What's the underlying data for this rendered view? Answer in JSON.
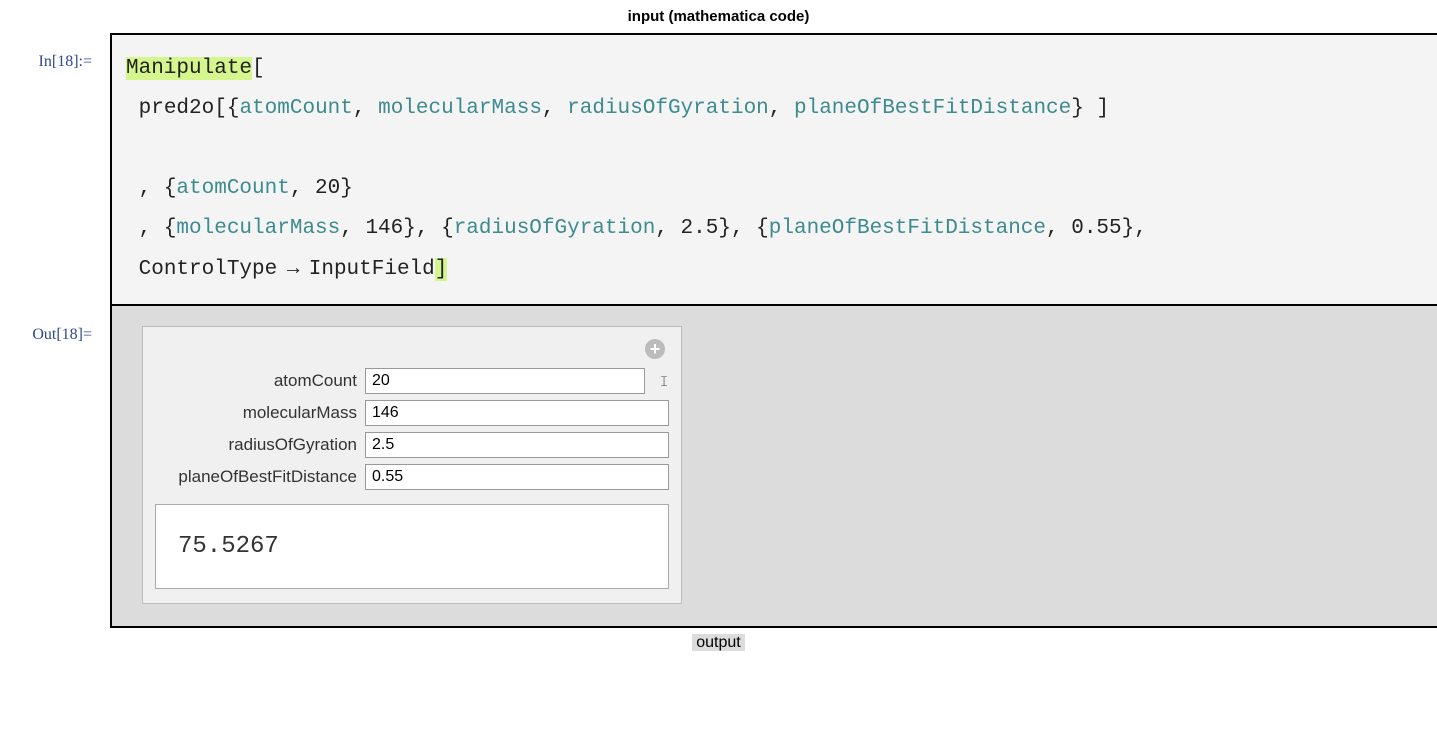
{
  "header_label": "input (mathematica code)",
  "footer_label": "output",
  "in_label": "In[18]:=",
  "out_label": "Out[18]=",
  "code": {
    "fn_main": "Manipulate",
    "lbracket": "[",
    "pred": "pred2o",
    "open_args": "[{",
    "arg1": "atomCount",
    "arg2": "molecularMass",
    "arg3": "radiusOfGyration",
    "arg4": "planeOfBestFitDistance",
    "close_args": "} ]",
    "sep": ", ",
    "line2_open": ", {",
    "line2_sym": "atomCount",
    "line2_rest": ", 20}",
    "line3_p1_open": ", {",
    "line3_p1_sym": "molecularMass",
    "line3_p1_rest": ", 146}",
    "line3_p2_open": ", {",
    "line3_p2_sym": "radiusOfGyration",
    "line3_p2_rest": ", 2.5}",
    "line3_p3_open": ", {",
    "line3_p3_sym": "planeOfBestFitDistance",
    "line3_p3_rest": ", 0.55},",
    "line4_a": "ControlType",
    "line4_arrow": " → ",
    "line4_b": "InputField",
    "rbracket": "]"
  },
  "controls": [
    {
      "label": "atomCount",
      "value": "20"
    },
    {
      "label": "molecularMass",
      "value": "146"
    },
    {
      "label": "radiusOfGyration",
      "value": "2.5"
    },
    {
      "label": "planeOfBestFitDistance",
      "value": "0.55"
    }
  ],
  "result": "75.5267",
  "plus_glyph": "+"
}
